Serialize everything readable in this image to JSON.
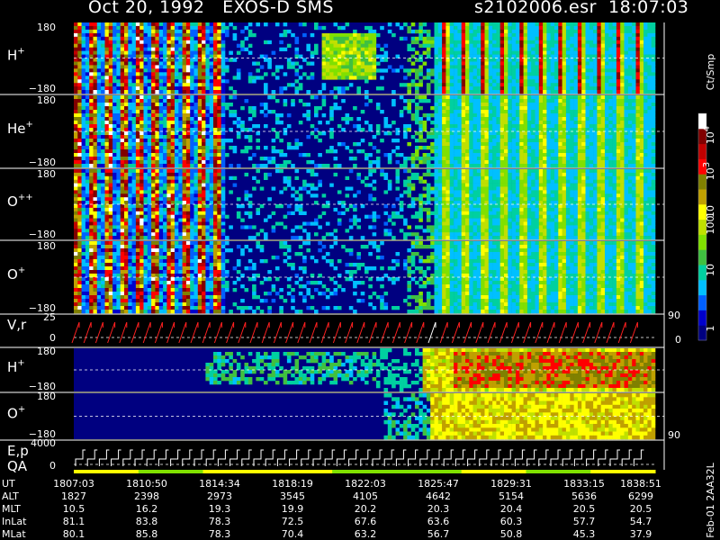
{
  "header": {
    "title_left": "Oct 20, 1992   EXOS-D SMS",
    "title_right": "s2102006.esr  18:07:03"
  },
  "side_label": "Feb-01 2AA32L",
  "chart_data": {
    "type": "heatmap",
    "time_axis": [
      "1807:03",
      "1810:50",
      "1814:34",
      "1818:19",
      "1822:03",
      "1825:47",
      "1829:31",
      "1833:15",
      "1838:51"
    ],
    "panels": [
      {
        "id": "h_plus",
        "label": "H",
        "sup": "+",
        "ytop": "180",
        "ybot": "−180"
      },
      {
        "id": "he_plus",
        "label": "He",
        "sup": "+",
        "ytop": "180",
        "ybot": "−180"
      },
      {
        "id": "o_pp",
        "label": "O",
        "sup": "++",
        "ytop": "180",
        "ybot": "−180"
      },
      {
        "id": "o_plus",
        "label": "O",
        "sup": "+",
        "ytop": "180",
        "ybot": "−180"
      }
    ],
    "vr_panel": {
      "label": "V,r",
      "ytop": "25",
      "ybot": "0",
      "right_top": "90",
      "right_bot": "0"
    },
    "lower_panels": [
      {
        "id": "h_plus_2",
        "label": "H",
        "sup": "+",
        "ytop": "180",
        "ybot": "−180"
      },
      {
        "id": "o_plus_2",
        "label": "O",
        "sup": "+",
        "ytop": "180",
        "ybot": "−180",
        "right_bot": "90"
      }
    ],
    "ep_panel": {
      "label1": "E,p",
      "label2": "QA",
      "ytop": "4000",
      "ybot": "0"
    },
    "colorbar": {
      "unit": "Ct/Smp",
      "ticks": [
        "10",
        "10",
        "10",
        "100",
        "10",
        "1"
      ],
      "sups": [
        "4",
        "3",
        "",
        "",
        "",
        ""
      ],
      "colors": [
        "#000080",
        "#0000cc",
        "#0060ff",
        "#00c0ff",
        "#00d0a0",
        "#40c040",
        "#80e000",
        "#c0e000",
        "#ffff00",
        "#c0a000",
        "#808000",
        "#ff0000",
        "#c00000",
        "#800000",
        "#ffffff"
      ]
    },
    "orbit_table": {
      "rows": [
        {
          "label": "UT",
          "values": [
            "1807:03",
            "1810:50",
            "1814:34",
            "1818:19",
            "1822:03",
            "1825:47",
            "1829:31",
            "1833:15",
            "1838:51"
          ]
        },
        {
          "label": "ALT",
          "values": [
            "1827",
            "2398",
            "2973",
            "3545",
            "4105",
            "4642",
            "5154",
            "5636",
            "6299"
          ]
        },
        {
          "label": "MLT",
          "values": [
            "10.5",
            "16.2",
            "19.3",
            "19.9",
            "20.2",
            "20.3",
            "20.4",
            "20.5",
            "20.5"
          ]
        },
        {
          "label": "InLat",
          "values": [
            "81.1",
            "83.8",
            "78.3",
            "72.5",
            "67.6",
            "63.6",
            "60.3",
            "57.7",
            "54.7"
          ]
        },
        {
          "label": "MLat",
          "values": [
            "80.1",
            "85.8",
            "78.3",
            "70.4",
            "63.2",
            "56.7",
            "50.8",
            "45.3",
            "37.9"
          ]
        }
      ]
    }
  }
}
